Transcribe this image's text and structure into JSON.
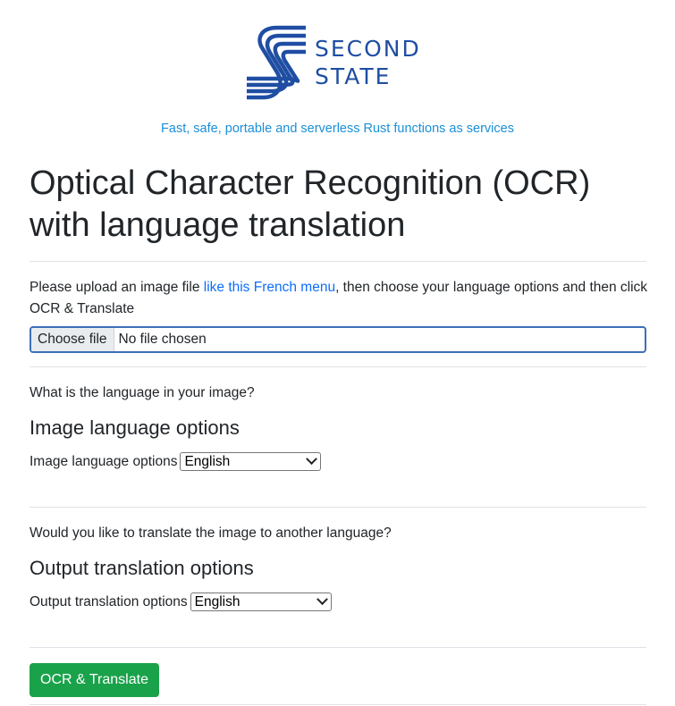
{
  "brand": {
    "logo_line1": "SECOND",
    "logo_line2": "STATE",
    "logo_color": "#1f4ea3"
  },
  "tagline": "Fast, safe, portable and serverless Rust functions as services",
  "page_title": "Optical Character Recognition (OCR) with language translation",
  "upload": {
    "text_before": "Please upload an image file ",
    "link_text": "like this French menu",
    "text_after": ", then choose your language options and then click OCR & Translate",
    "choose_label": "Choose file",
    "status": "No file chosen"
  },
  "image_language": {
    "question": "What is the language in your image?",
    "heading": "Image language options",
    "label": "Image language options",
    "selected": "English"
  },
  "output_language": {
    "question": "Would you like to translate the image to another language?",
    "heading": "Output translation options",
    "label": "Output translation options",
    "selected": "English"
  },
  "submit_label": "OCR & Translate",
  "colors": {
    "link": "#0d6efd",
    "tagline": "#1a8fd8",
    "submit": "#1aa24a"
  }
}
